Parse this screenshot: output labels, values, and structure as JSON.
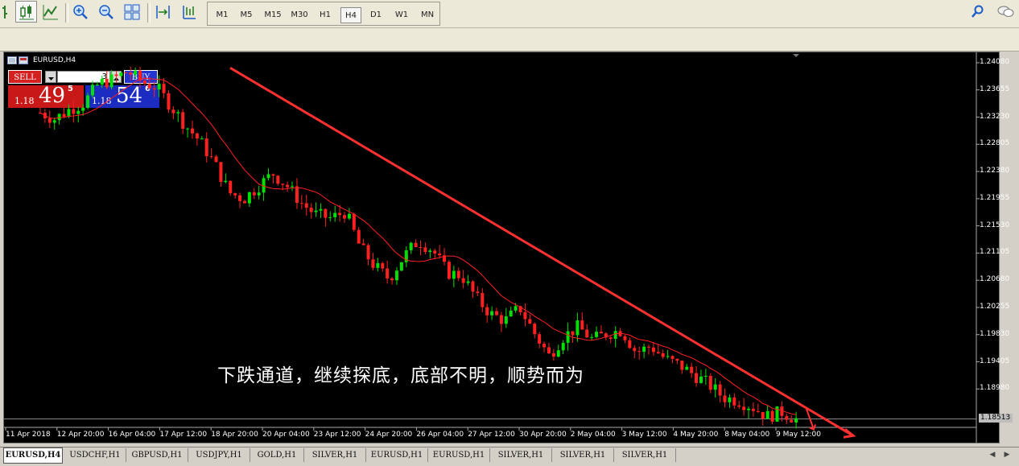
{
  "toolbar": {
    "icons": [
      "bar-chart-icon",
      "candlestick-icon",
      "line-chart-icon",
      "zoom-in-icon",
      "zoom-out-icon",
      "tile-windows-icon",
      "chart-shift-icon",
      "autoscroll-icon",
      "search-icon",
      "chat-icon"
    ],
    "timeframes": [
      "M1",
      "M5",
      "M15",
      "M30",
      "H1",
      "H4",
      "D1",
      "W1",
      "MN"
    ],
    "active_timeframe": "H4"
  },
  "chart": {
    "title": "EURUSD,H4",
    "trade": {
      "sell_label": "SELL",
      "buy_label": "BUY",
      "lot": "3",
      "sell_price_small": "1.18",
      "sell_price_big": "49",
      "sell_price_sup": "5",
      "buy_price_small": "1.18",
      "buy_price_big": "54",
      "buy_price_sup": "6"
    },
    "current_price": "1.18513",
    "annotation": "下跌通道，继续探底，底部不明，顺势而为",
    "colors": {
      "background": "#000000",
      "bull": "#00e000",
      "bear": "#ff2020",
      "ma": "#ff2020",
      "trendline": "#ff3030",
      "sell": "#c81818",
      "buy": "#1c2cc0"
    }
  },
  "chart_data": {
    "type": "candlestick",
    "symbol": "EURUSD",
    "timeframe": "H4",
    "y_ticks": [
      "1.24080",
      "1.23655",
      "1.23230",
      "1.22805",
      "1.22380",
      "1.21955",
      "1.21530",
      "1.21105",
      "1.20680",
      "1.20255",
      "1.19830",
      "1.19405",
      "1.18980"
    ],
    "x_ticks": [
      "11 Apr 2018",
      "12 Apr 20:00",
      "16 Apr 04:00",
      "17 Apr 12:00",
      "18 Apr 20:00",
      "20 Apr 04:00",
      "23 Apr 12:00",
      "24 Apr 20:00",
      "26 Apr 04:00",
      "27 Apr 12:00",
      "30 Apr 20:00",
      "2 May 04:00",
      "3 May 12:00",
      "4 May 20:00",
      "8 May 04:00",
      "9 May 12:00"
    ],
    "ylim": [
      1.1838,
      1.2418
    ],
    "current_price": 1.18513,
    "close_path": [
      1.233,
      1.232,
      1.2335,
      1.2345,
      1.2375,
      1.2382,
      1.2395,
      1.2378,
      1.237,
      1.234,
      1.231,
      1.2285,
      1.225,
      1.2205,
      1.2195,
      1.2215,
      1.2235,
      1.2215,
      1.2188,
      1.217,
      1.2165,
      1.2175,
      1.212,
      1.209,
      1.207,
      1.2105,
      1.213,
      1.2115,
      1.208,
      1.2075,
      1.204,
      1.2015,
      1.2005,
      1.2025,
      1.1985,
      1.195,
      1.198,
      1.1995,
      1.1975,
      1.1985,
      1.199,
      1.1955,
      1.1965,
      1.1945,
      1.1935,
      1.192,
      1.1905,
      1.1885,
      1.188,
      1.187,
      1.1855,
      1.1862,
      1.1851
    ],
    "trendline": {
      "start_x": "18 Apr 20:00",
      "start_y": 1.24,
      "end_y": 1.1825
    },
    "series": [
      {
        "name": "EURUSD,H4"
      }
    ]
  },
  "tabs": [
    "EURUSD,H4",
    "USDCHF,H1",
    "GBPUSD,H1",
    "USDJPY,H1",
    "GOLD,H1",
    "SILVER,H1",
    "EURUSD,H1",
    "EURUSD,H1",
    "SILVER,H1",
    "SILVER,H1",
    "SILVER,H1"
  ],
  "active_tab": "EURUSD,H4"
}
